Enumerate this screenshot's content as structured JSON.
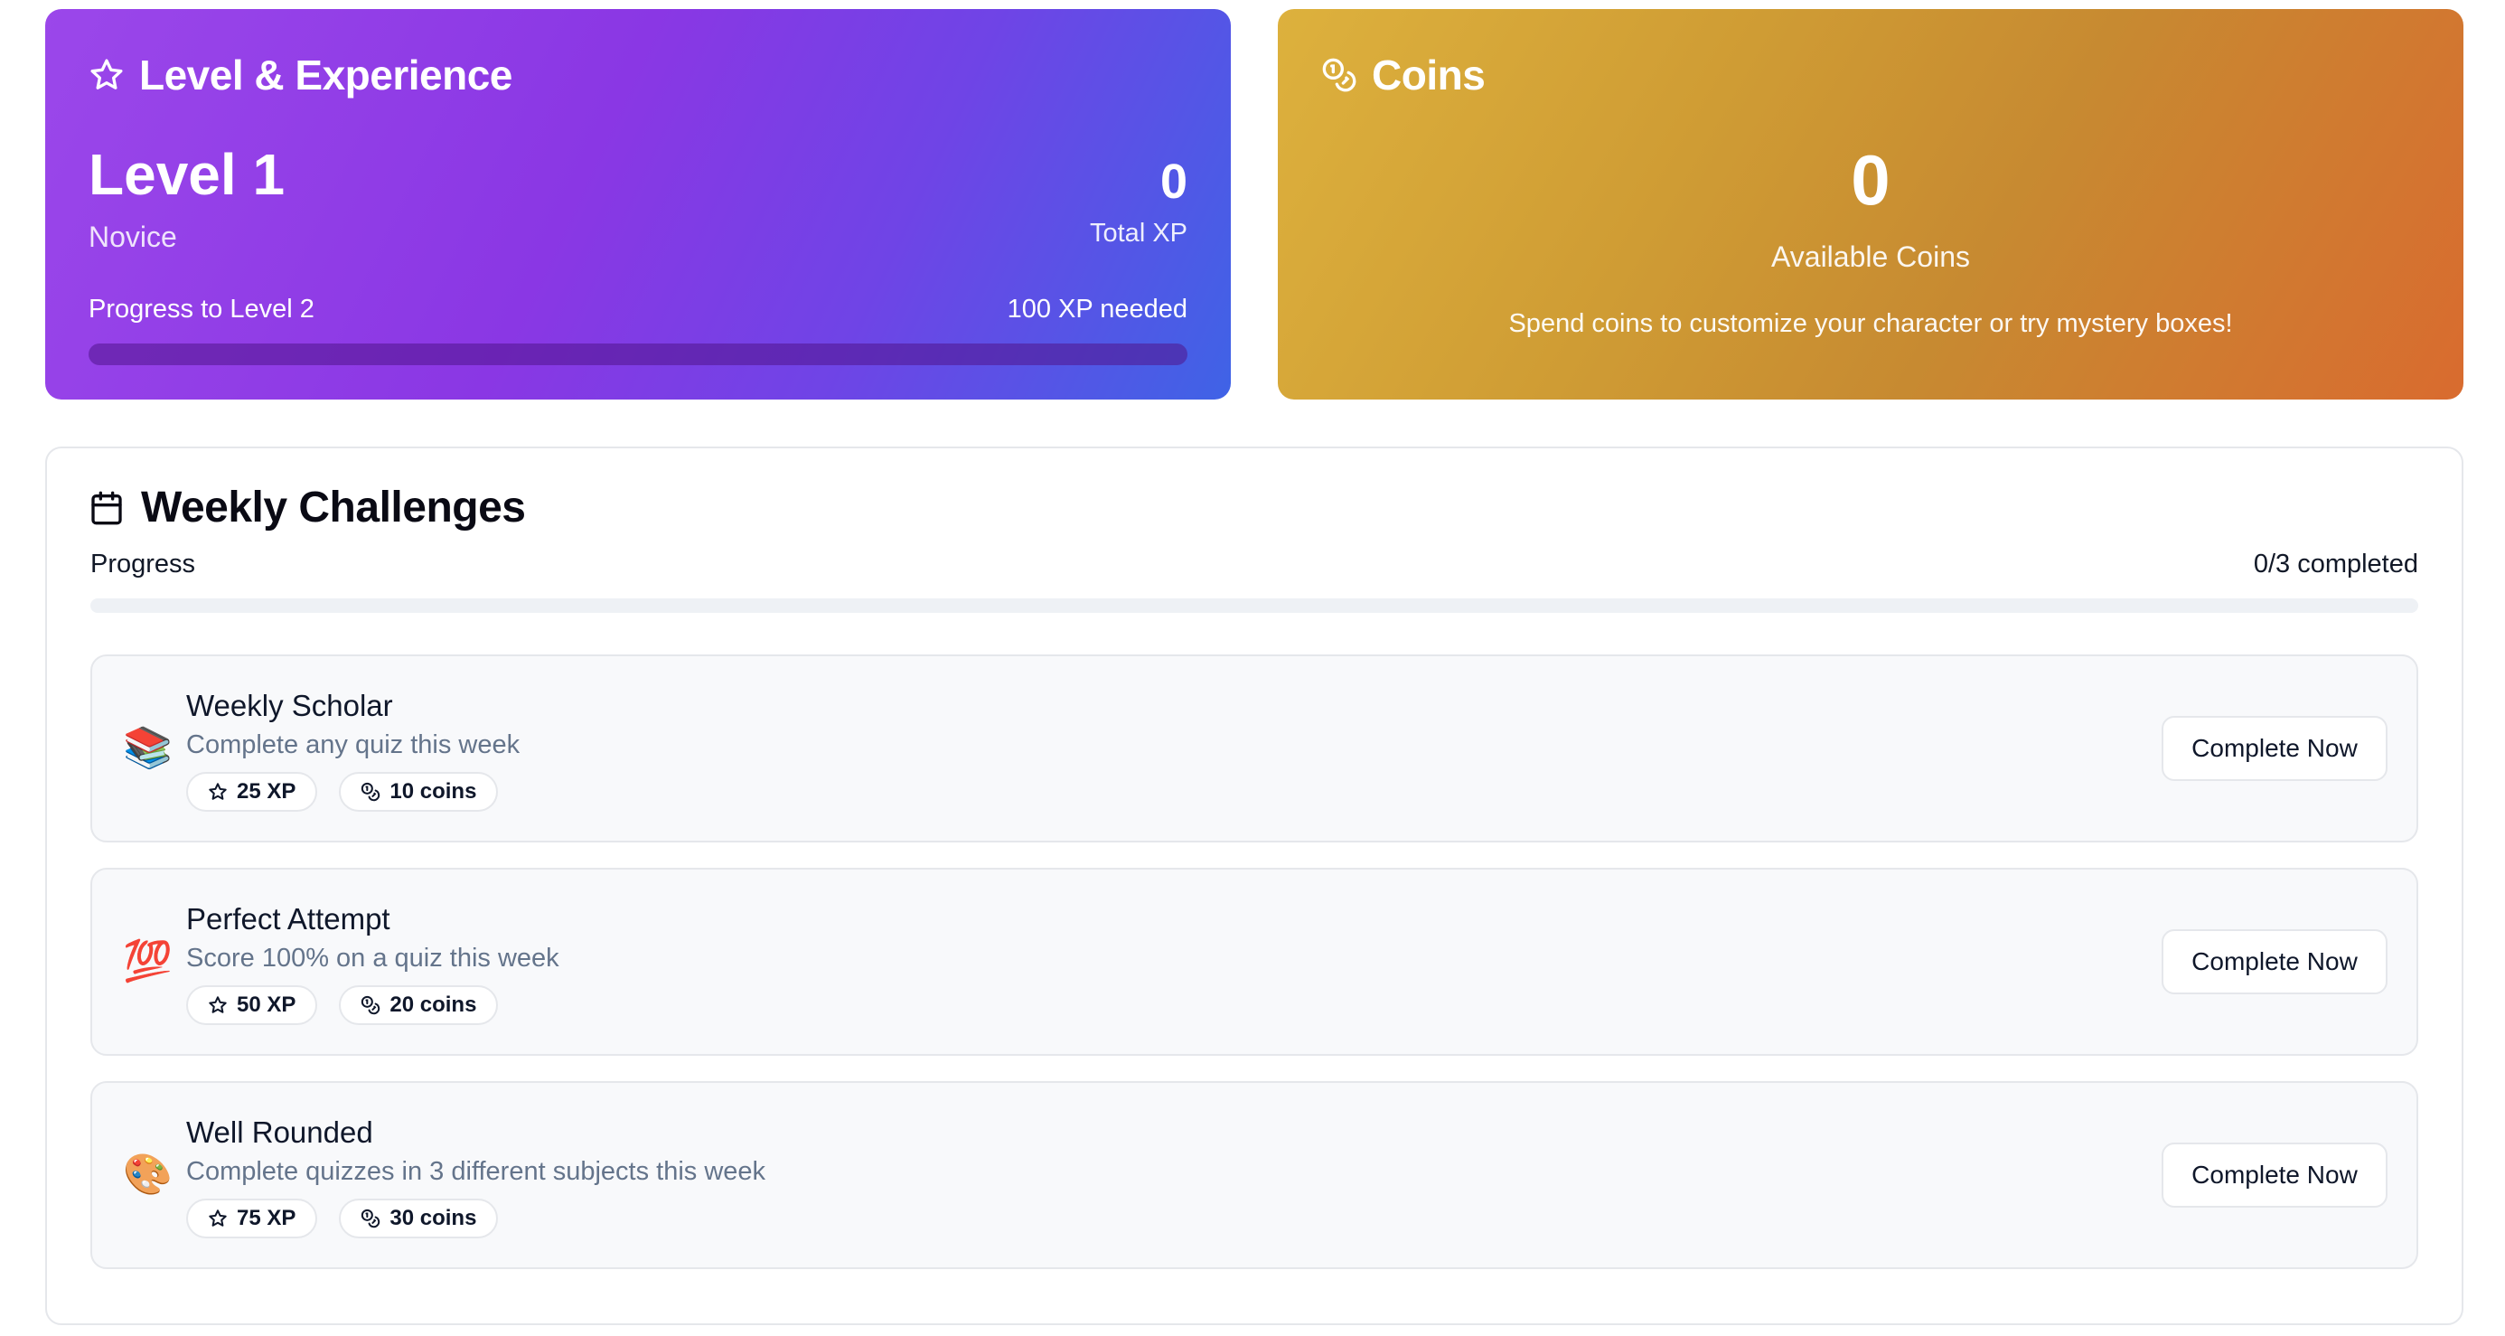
{
  "level_card": {
    "title": "Level & Experience",
    "level": "Level 1",
    "rank": "Novice",
    "total_xp": "0",
    "total_xp_label": "Total XP",
    "progress_label": "Progress to Level 2",
    "xp_needed": "100 XP needed",
    "progress_fraction": 0
  },
  "coins_card": {
    "title": "Coins",
    "amount": "0",
    "amount_label": "Available Coins",
    "description": "Spend coins to customize your character or try mystery boxes!"
  },
  "weekly": {
    "title": "Weekly Challenges",
    "progress_label": "Progress",
    "progress_count": "0/3 completed",
    "progress_fraction": 0,
    "items": [
      {
        "icon": "books-emoji",
        "emoji": "📚",
        "name": "Weekly Scholar",
        "description": "Complete any quiz this week",
        "xp": "25 XP",
        "coins": "10 coins",
        "button": "Complete Now"
      },
      {
        "icon": "hundred-points-emoji",
        "emoji": "💯",
        "name": "Perfect Attempt",
        "description": "Score 100% on a quiz this week",
        "xp": "50 XP",
        "coins": "20 coins",
        "button": "Complete Now"
      },
      {
        "icon": "artist-palette-emoji",
        "emoji": "🎨",
        "name": "Well Rounded",
        "description": "Complete quizzes in 3 different subjects this week",
        "xp": "75 XP",
        "coins": "30 coins",
        "button": "Complete Now"
      }
    ]
  }
}
